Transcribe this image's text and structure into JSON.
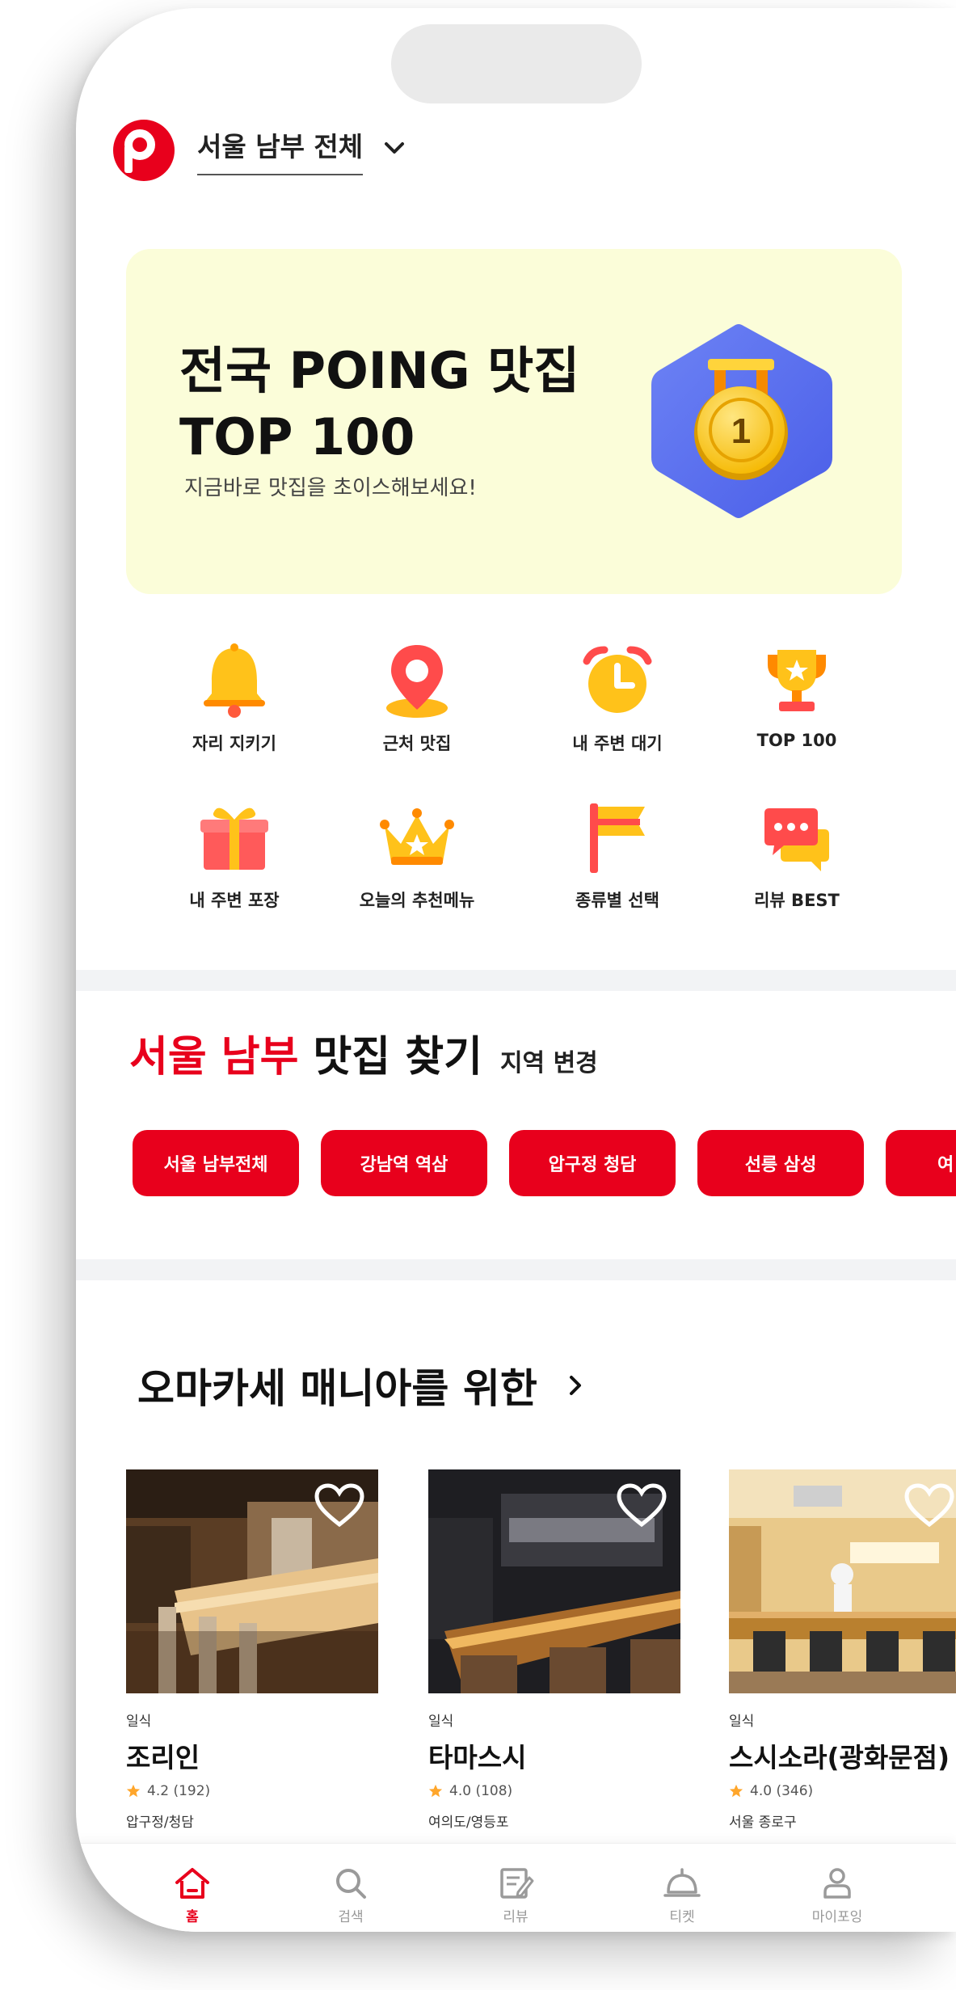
{
  "header": {
    "region_label": "서울 남부 전체"
  },
  "banner": {
    "title": "전국 POING 맛집\nTOP 100",
    "subtitle": "지금바로 맛집을 초이스해보세요!",
    "medal_number": "1"
  },
  "quick_menu": [
    {
      "label": "자리 지키기",
      "icon": "bell-icon"
    },
    {
      "label": "근처 맛집",
      "icon": "location-pin-icon"
    },
    {
      "label": "내 주변 대기",
      "icon": "alarm-clock-icon"
    },
    {
      "label": "TOP 100",
      "icon": "trophy-icon"
    },
    {
      "label": "내 주변 포장",
      "icon": "gift-box-icon"
    },
    {
      "label": "오늘의 추천메뉴",
      "icon": "crown-icon"
    },
    {
      "label": "종류별 선택",
      "icon": "flag-icon"
    },
    {
      "label": "리뷰 BEST",
      "icon": "chat-bubble-icon"
    }
  ],
  "region_section": {
    "heading_highlight": "서울 남부",
    "heading_rest": "맛집 찾기",
    "change_label": "지역 변경",
    "chips": [
      "서울 남부전체",
      "강남역 역삼",
      "압구정 청담",
      "선릉 삼성",
      "여"
    ]
  },
  "omakase_section": {
    "title": "오마카세 매니아를 위한",
    "restaurants": [
      {
        "category": "일식",
        "name": "조리인",
        "rating": "4.2 (192)",
        "location": "압구정/청담"
      },
      {
        "category": "일식",
        "name": "타마스시",
        "rating": "4.0 (108)",
        "location": "여의도/영등포"
      },
      {
        "category": "일식",
        "name": "스시소라(광화문점)",
        "rating": "4.0 (346)",
        "location": "서울 종로구"
      }
    ]
  },
  "bottom_nav": [
    {
      "label": "홈",
      "icon": "home-icon",
      "active": true
    },
    {
      "label": "검색",
      "icon": "search-icon",
      "active": false
    },
    {
      "label": "리뷰",
      "icon": "review-edit-icon",
      "active": false
    },
    {
      "label": "티켓",
      "icon": "service-bell-icon",
      "active": false
    },
    {
      "label": "마이포잉",
      "icon": "person-icon",
      "active": false
    }
  ],
  "colors": {
    "brand_red": "#e8001c",
    "banner_bg": "#fbfdd9",
    "separator": "#f2f3f5"
  }
}
